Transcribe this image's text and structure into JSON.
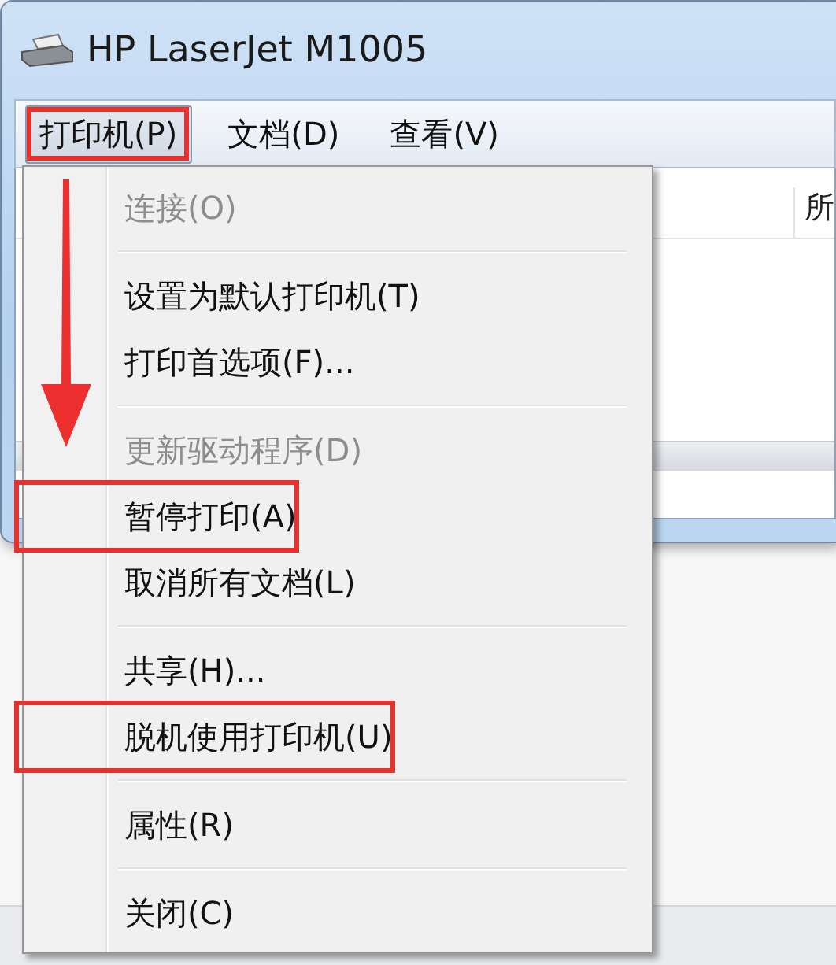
{
  "window": {
    "title": "HP LaserJet M1005"
  },
  "menu_bar": [
    {
      "label": "打印机(P)",
      "open": true,
      "marked": true
    },
    {
      "label": "文档(D)",
      "open": false,
      "marked": false
    },
    {
      "label": "查看(V)",
      "open": false,
      "marked": false
    }
  ],
  "list": {
    "columns": [
      "所"
    ]
  },
  "menu": {
    "items": [
      {
        "kind": "item",
        "label": "连接(O)",
        "disabled": true,
        "marked": false
      },
      {
        "kind": "separator"
      },
      {
        "kind": "item",
        "label": "设置为默认打印机(T)",
        "disabled": false,
        "marked": false
      },
      {
        "kind": "item",
        "label": "打印首选项(F)...",
        "disabled": false,
        "marked": false
      },
      {
        "kind": "separator"
      },
      {
        "kind": "item",
        "label": "更新驱动程序(D)",
        "disabled": true,
        "marked": false
      },
      {
        "kind": "item",
        "label": "暂停打印(A)",
        "disabled": false,
        "marked": true
      },
      {
        "kind": "item",
        "label": "取消所有文档(L)",
        "disabled": false,
        "marked": false
      },
      {
        "kind": "separator"
      },
      {
        "kind": "item",
        "label": "共享(H)...",
        "disabled": false,
        "marked": false
      },
      {
        "kind": "item",
        "label": "脱机使用打印机(U)",
        "disabled": false,
        "marked": true
      },
      {
        "kind": "separator"
      },
      {
        "kind": "item",
        "label": "属性(R)",
        "disabled": false,
        "marked": false
      },
      {
        "kind": "separator"
      },
      {
        "kind": "item",
        "label": "关闭(C)",
        "disabled": false,
        "marked": false
      }
    ]
  },
  "annotation_arrow": true
}
